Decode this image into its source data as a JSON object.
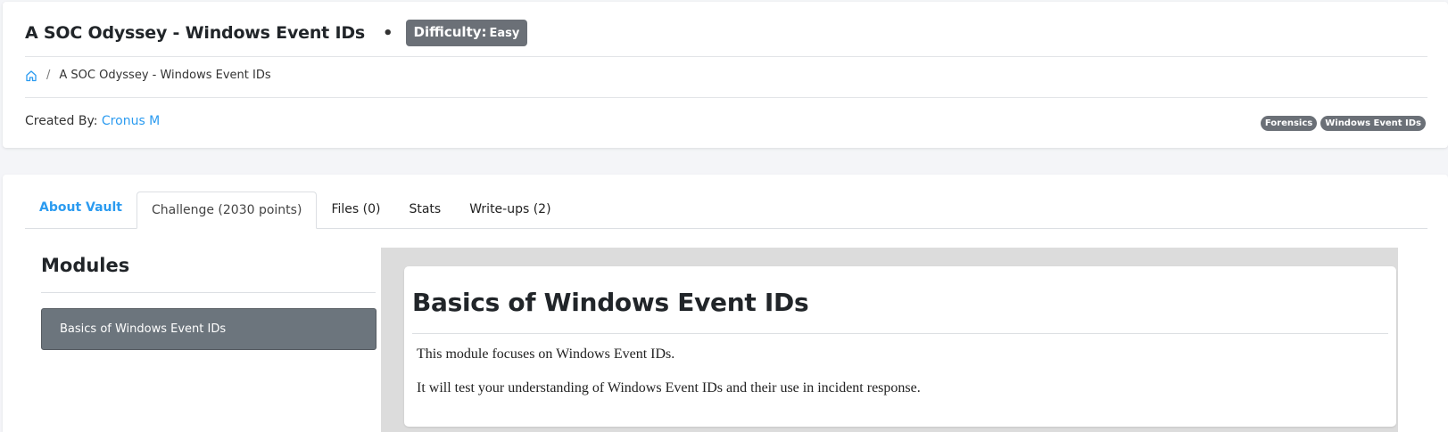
{
  "header": {
    "title": "A SOC Odyssey - Windows Event IDs",
    "separator": "•",
    "difficulty_label": "Difficulty:",
    "difficulty_value": "Easy"
  },
  "breadcrumb": {
    "home_icon": "home-icon",
    "separator": "/",
    "current": "A SOC Odyssey - Windows Event IDs"
  },
  "created": {
    "label": "Created By:",
    "author": "Cronus M"
  },
  "tags": [
    "Forensics",
    "Windows Event IDs"
  ],
  "tabs": [
    {
      "label": "About Vault"
    },
    {
      "label": "Challenge (2030 points)"
    },
    {
      "label": "Files (0)"
    },
    {
      "label": "Stats"
    },
    {
      "label": "Write-ups (2)"
    }
  ],
  "modules": {
    "title": "Modules",
    "items": [
      {
        "label": "Basics of Windows Event IDs"
      }
    ]
  },
  "content": {
    "title": "Basics of Windows Event IDs",
    "paragraphs": [
      "This module focuses on Windows Event IDs.",
      "It will test your understanding of Windows Event IDs and their use in incident response."
    ]
  },
  "colors": {
    "accent": "#2b9bf0",
    "badge": "#6b7077",
    "module_active": "#6c757d"
  }
}
